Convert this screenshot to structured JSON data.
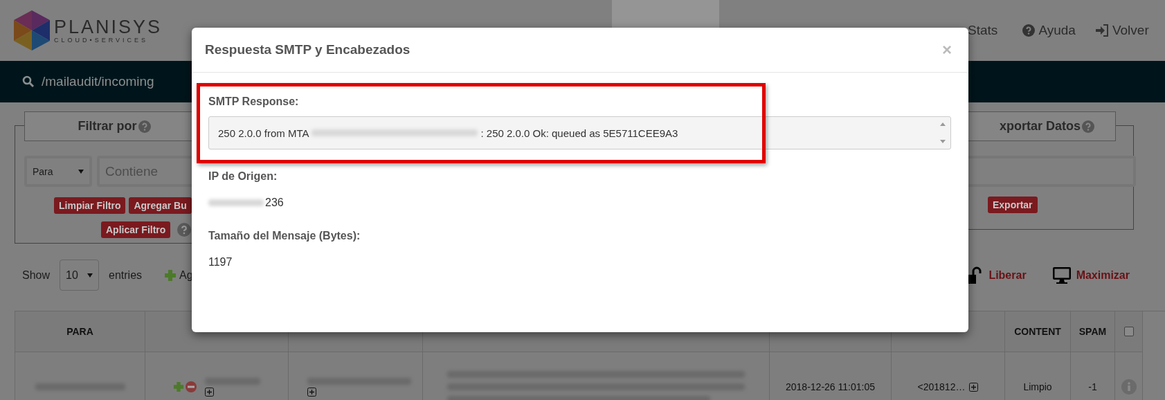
{
  "logo": {
    "name": "PLANISYS",
    "tagline": "CLOUD•SERVICES"
  },
  "nav": [
    {
      "selected": true
    },
    {
      "label": "Stats",
      "selected": false
    },
    {
      "label": "Ayuda",
      "selected": false
    },
    {
      "label": "Volver",
      "selected": false
    }
  ],
  "path_bar": {
    "path": "/mailaudit/incoming"
  },
  "filter_panel": {
    "title": "Filtrar por",
    "field": "Para",
    "placeholder": "Contiene",
    "buttons": [
      "Limpiar Filtro",
      "Agregar Bu"
    ],
    "apply": "Aplicar Filtro"
  },
  "export_panel": {
    "title": "xportar Datos",
    "button": "Exportar"
  },
  "entries": {
    "show": "Show",
    "count": "10",
    "label": "entries",
    "add": "Ag"
  },
  "actions": [
    "Liberar",
    "Maximizar"
  ],
  "table": {
    "columns": [
      {
        "label": "PARA"
      },
      {
        "label": "CONTENT"
      },
      {
        "label": "SPAM"
      },
      {
        "kind": "checkbox",
        "checked": false
      }
    ],
    "rows": [
      {
        "hora": "2018-12-26 11:01:05",
        "message_id": "<201812…",
        "content": "Limpio",
        "spam": "-1"
      }
    ]
  },
  "modal": {
    "title": "Respuesta SMTP y Encabezados",
    "close": "×",
    "smtp_label": "SMTP Response:",
    "smtp_prefix": "250 2.0.0 from MTA",
    "smtp_suffix": ": 250 2.0.0 Ok: queued as 5E5711CEE9A3",
    "ip_label": "IP de Origen:",
    "ip_suffix": "236",
    "size_label": "Tamaño del Mensaje (Bytes):",
    "size_value": "1197"
  }
}
